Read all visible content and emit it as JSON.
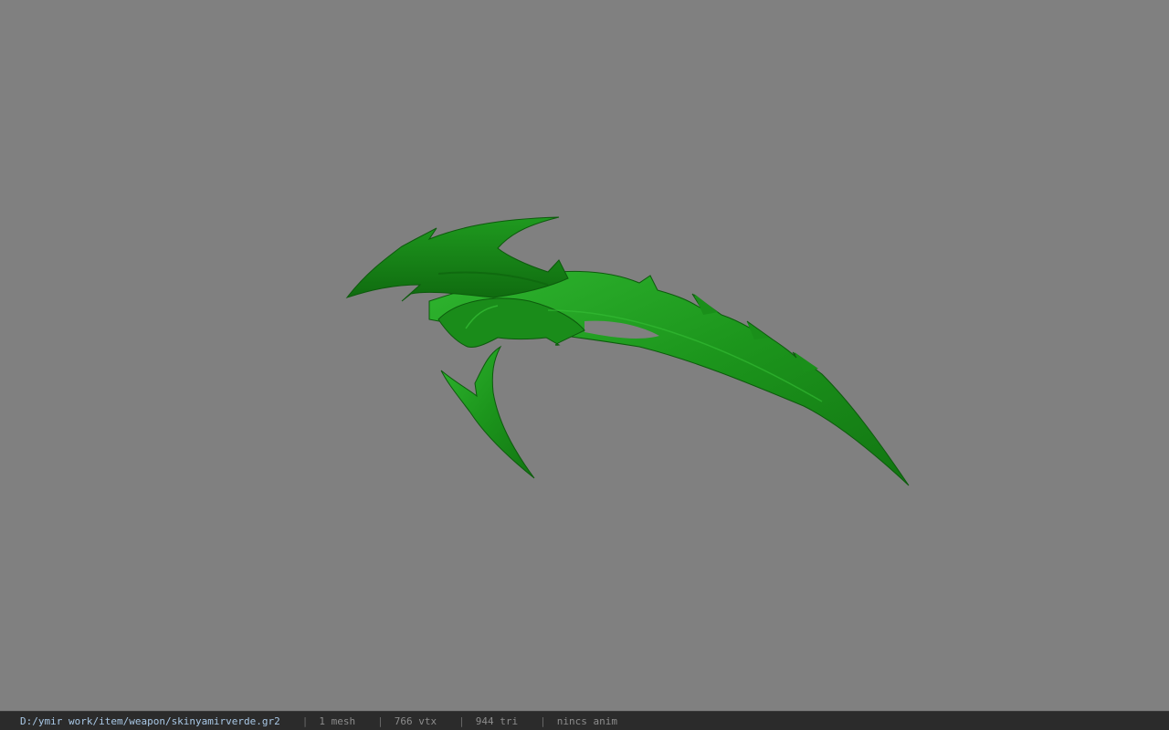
{
  "viewport": {
    "background": "#808080",
    "model": {
      "name": "green-scythe-blade-model",
      "color": "#1f9e1f"
    }
  },
  "statusbar": {
    "file_path": "D:/ymir work/item/weapon/skinyamirverde.gr2",
    "separator": "|",
    "mesh_count": "1 mesh",
    "vertex_count": "766 vtx",
    "triangle_count": "944 tri",
    "anim": "nincs anim"
  }
}
